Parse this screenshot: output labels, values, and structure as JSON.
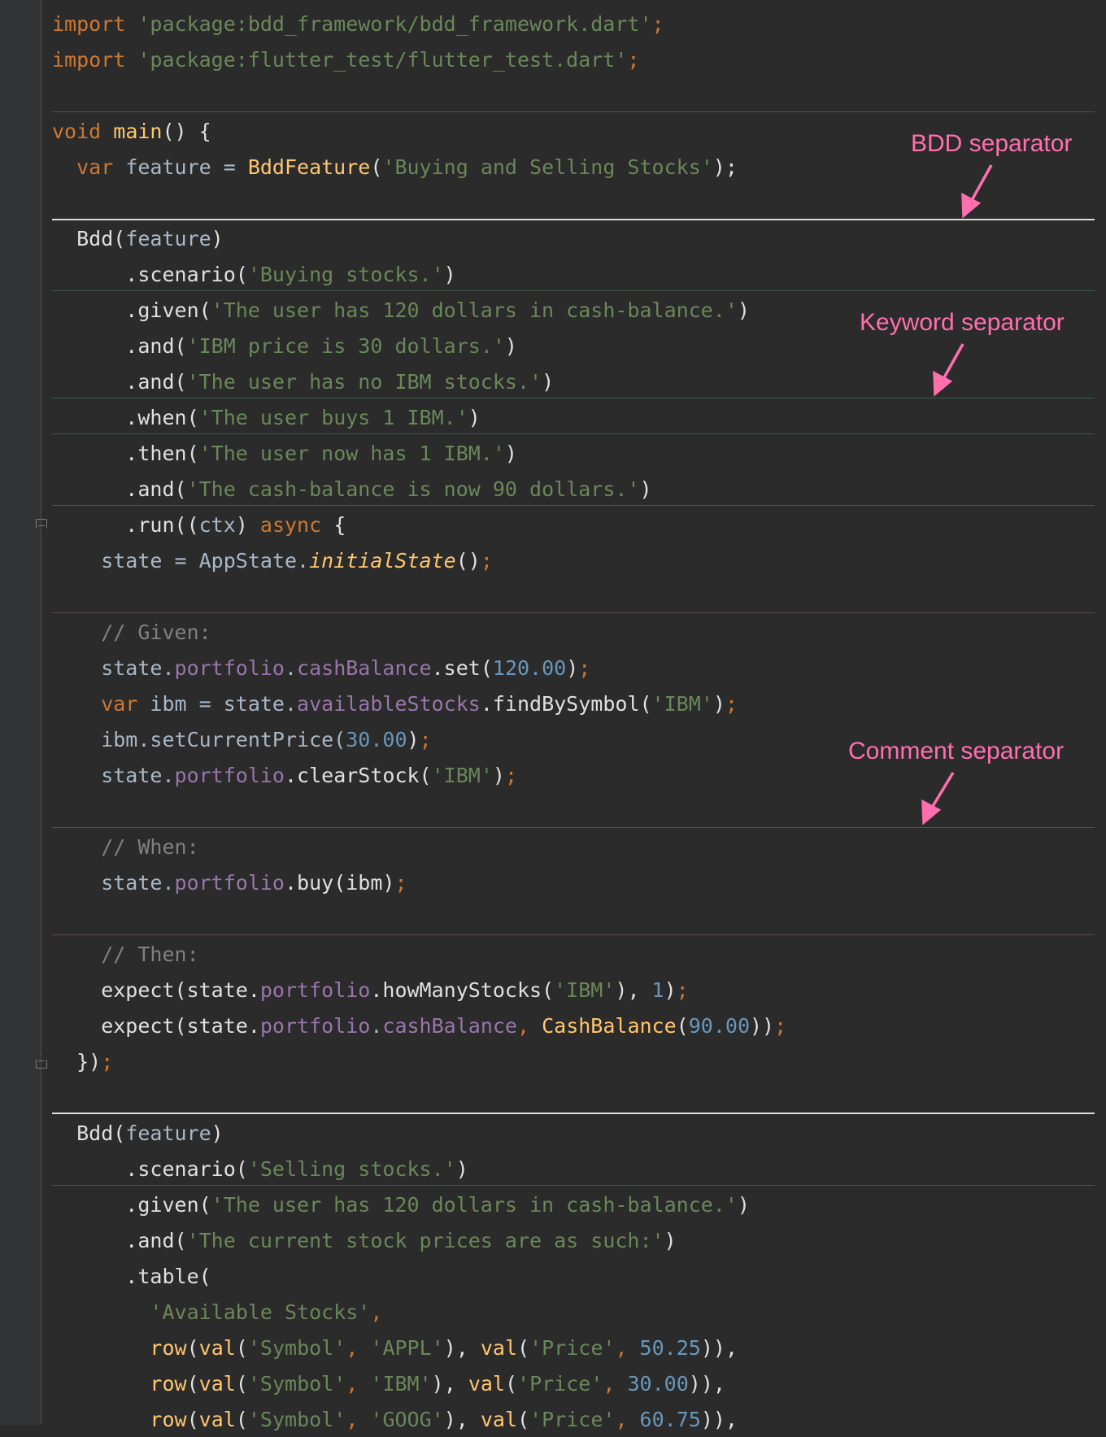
{
  "annotations": {
    "bdd_separator": "BDD separator",
    "keyword_separator": "Keyword separator",
    "comment_separator": "Comment separator"
  },
  "code": {
    "l1": {
      "a": "import ",
      "b": "'package:bdd_framework/bdd_framework.dart'",
      "c": ";"
    },
    "l2": {
      "a": "import ",
      "b": "'package:flutter_test/flutter_test.dart'",
      "c": ";"
    },
    "l3": {
      "a": "void ",
      "b": "main",
      "c": "() {"
    },
    "l4": {
      "a": "  var ",
      "b": "feature = ",
      "c": "BddFeature",
      "d": "(",
      "e": "'Buying and Selling Stocks'",
      "f": ");"
    },
    "l5": {
      "a": "  Bdd(",
      "b": "feature",
      "c": ")"
    },
    "l6": {
      "a": "      .scenario(",
      "b": "'Buying stocks.'",
      "c": ")"
    },
    "l7": {
      "a": "      .given(",
      "b": "'The user has 120 dollars in cash-balance.'",
      "c": ")"
    },
    "l8": {
      "a": "      .and(",
      "b": "'IBM price is 30 dollars.'",
      "c": ")"
    },
    "l9": {
      "a": "      .and(",
      "b": "'The user has no IBM stocks.'",
      "c": ")"
    },
    "l10": {
      "a": "      .when(",
      "b": "'The user buys 1 IBM.'",
      "c": ")"
    },
    "l11": {
      "a": "      .then(",
      "b": "'The user now has 1 IBM.'",
      "c": ")"
    },
    "l12": {
      "a": "      .and(",
      "b": "'The cash-balance is now 90 dollars.'",
      "c": ")"
    },
    "l13": {
      "a": "      .run((",
      "b": "ctx",
      "c": ") ",
      "d": "async",
      "e": " {"
    },
    "l14": {
      "a": "    state = AppState.",
      "b": "initialState",
      "c": "()",
      "d": ";"
    },
    "l15": {
      "a": "    // Given:"
    },
    "l16": {
      "a": "    state.",
      "b": "portfolio",
      "c": ".",
      "d": "cashBalance",
      "e": ".set(",
      "f": "120.00",
      "g": ")",
      "h": ";"
    },
    "l17": {
      "a": "    var ",
      "b": "ibm = state.",
      "c": "availableStocks",
      "d": ".findBySymbol(",
      "e": "'IBM'",
      "f": ")",
      "g": ";"
    },
    "l18": {
      "a": "    ibm.setCurrentPrice(",
      "b": "30.00",
      "c": ")",
      "d": ";"
    },
    "l19": {
      "a": "    state.",
      "b": "portfolio",
      "c": ".clearStock(",
      "d": "'IBM'",
      "e": ")",
      "f": ";"
    },
    "l20": {
      "a": "    // When:"
    },
    "l21": {
      "a": "    state.",
      "b": "portfolio",
      "c": ".buy(ibm)",
      "d": ";"
    },
    "l22": {
      "a": "    // Then:"
    },
    "l23": {
      "a": "    expect(state.",
      "b": "portfolio",
      "c": ".howManyStocks(",
      "d": "'IBM'",
      "e": "), ",
      "f": "1",
      "g": ")",
      "h": ";"
    },
    "l24": {
      "a": "    expect(state.",
      "b": "portfolio",
      "c": ".",
      "d": "cashBalance",
      "e": ", ",
      "f": "CashBalance",
      "g": "(",
      "h": "90.00",
      "i": "))",
      "j": ";"
    },
    "l25": {
      "a": "  })",
      "b": ";"
    },
    "l26": {
      "a": "  Bdd(",
      "b": "feature",
      "c": ")"
    },
    "l27": {
      "a": "      .scenario(",
      "b": "'Selling stocks.'",
      "c": ")"
    },
    "l28": {
      "a": "      .given(",
      "b": "'The user has 120 dollars in cash-balance.'",
      "c": ")"
    },
    "l29": {
      "a": "      .and(",
      "b": "'The current stock prices are as such:'",
      "c": ")"
    },
    "l30": {
      "a": "      .table("
    },
    "l31": {
      "a": "        ",
      "b": "'Available Stocks'",
      "c": ","
    },
    "l32": {
      "a": "        ",
      "b": "row",
      "c": "(",
      "d": "val",
      "e": "(",
      "f": "'Symbol'",
      "g": ", ",
      "h": "'APPL'",
      "i": "), ",
      "j": "val",
      "k": "(",
      "l": "'Price'",
      "m": ", ",
      "n": "50.25",
      "o": ")),"
    },
    "l33": {
      "a": "        ",
      "b": "row",
      "c": "(",
      "d": "val",
      "e": "(",
      "f": "'Symbol'",
      "g": ", ",
      "h": "'IBM'",
      "i": "), ",
      "j": "val",
      "k": "(",
      "l": "'Price'",
      "m": ", ",
      "n": "30.00",
      "o": ")),"
    },
    "l34": {
      "a": "        ",
      "b": "row",
      "c": "(",
      "d": "val",
      "e": "(",
      "f": "'Symbol'",
      "g": ", ",
      "h": "'GOOG'",
      "i": "), ",
      "j": "val",
      "k": "(",
      "l": "'Price'",
      "m": ", ",
      "n": "60.75",
      "o": ")),"
    }
  }
}
